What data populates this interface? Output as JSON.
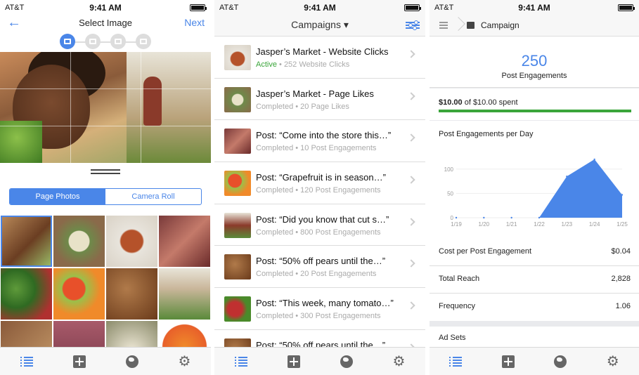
{
  "status": {
    "carrier": "AT&T",
    "time": "9:41 AM"
  },
  "panel1": {
    "back": "←",
    "title": "Select Image",
    "next": "Next",
    "segment": {
      "left": "Page Photos",
      "right": "Camera Roll"
    }
  },
  "panel2": {
    "title": "Campaigns ▾",
    "rows": [
      {
        "name": "Jasper’s Market - Website Clicks",
        "status": "Active",
        "metric": "252 Website Clicks",
        "active": true
      },
      {
        "name": "Jasper’s Market - Page Likes",
        "status": "Completed",
        "metric": "20 Page Likes"
      },
      {
        "name": "Post: “Come into the store this…”",
        "status": "Completed",
        "metric": "10 Post Engagements"
      },
      {
        "name": "Post: “Grapefruit is in season…”",
        "status": "Completed",
        "metric": "120 Post Engagements"
      },
      {
        "name": "Post: “Did you know that cut s…”",
        "status": "Completed",
        "metric": "800 Post Engagements"
      },
      {
        "name": "Post: “50% off pears until the…”",
        "status": "Completed",
        "metric": "20 Post Engagements"
      },
      {
        "name": "Post: “This week, many tomato…”",
        "status": "Completed",
        "metric": "300 Post Engagements"
      },
      {
        "name": "Post: “50% off pears until the…”",
        "status": "",
        "metric": ""
      }
    ],
    "separator": " • "
  },
  "panel3": {
    "nav_title": "Campaign",
    "kpi_value": "250",
    "kpi_label": "Post Engagements",
    "spent_amount": "$10.00",
    "spent_rest": " of $10.00 spent",
    "spent_fraction": 1.0,
    "chart_title": "Post Engagements per Day",
    "stats": [
      {
        "label": "Cost per Post Engagement",
        "value": "$0.04"
      },
      {
        "label": "Total Reach",
        "value": "2,828"
      },
      {
        "label": "Frequency",
        "value": "1.06"
      }
    ],
    "adsets": "Ad Sets"
  },
  "colors": {
    "accent": "#4a86e8",
    "active": "#3aa53a",
    "progress": "#3aa53a"
  },
  "chart_data": {
    "type": "area",
    "title": "Post Engagements per Day",
    "categories": [
      "1/19",
      "1/20",
      "1/21",
      "1/22",
      "1/23",
      "1/24",
      "1/25"
    ],
    "values": [
      0,
      0,
      0,
      0,
      85,
      120,
      47
    ],
    "yticks": [
      0,
      50,
      100
    ],
    "ylim": [
      0,
      130
    ],
    "grid": true
  }
}
